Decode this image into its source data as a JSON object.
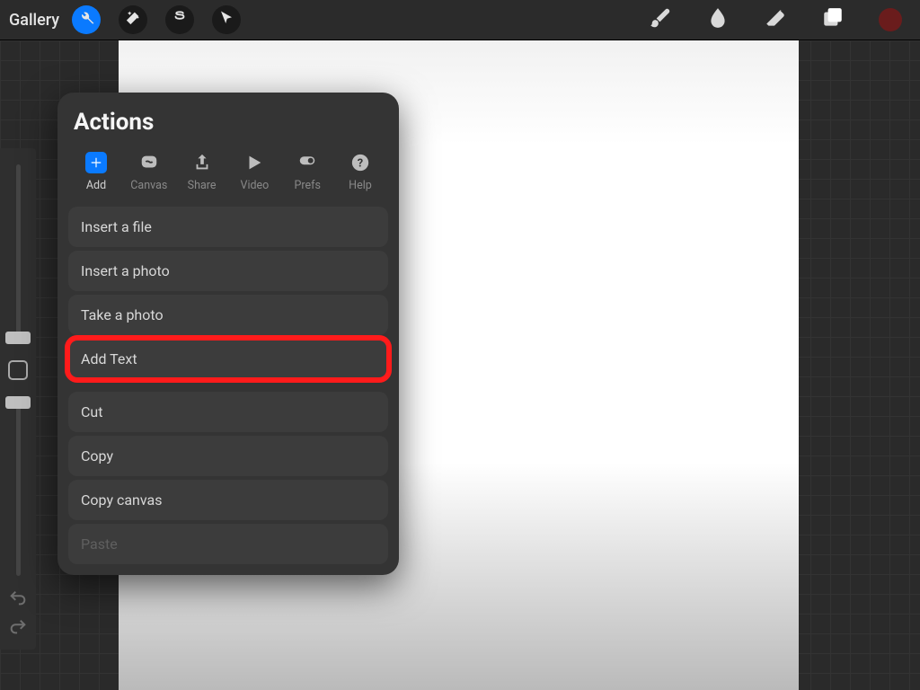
{
  "topbar": {
    "gallery_label": "Gallery"
  },
  "actions": {
    "title": "Actions",
    "tabs": {
      "add": "Add",
      "canvas": "Canvas",
      "share": "Share",
      "video": "Video",
      "prefs": "Prefs",
      "help": "Help"
    },
    "menu": {
      "insert_file": "Insert a file",
      "insert_photo": "Insert a photo",
      "take_photo": "Take a photo",
      "add_text": "Add Text",
      "cut": "Cut",
      "copy": "Copy",
      "copy_canvas": "Copy canvas",
      "paste": "Paste"
    }
  },
  "colors": {
    "accent": "#0a7aff",
    "highlight": "#ff1b1b",
    "current_color": "#6a1c1c"
  }
}
